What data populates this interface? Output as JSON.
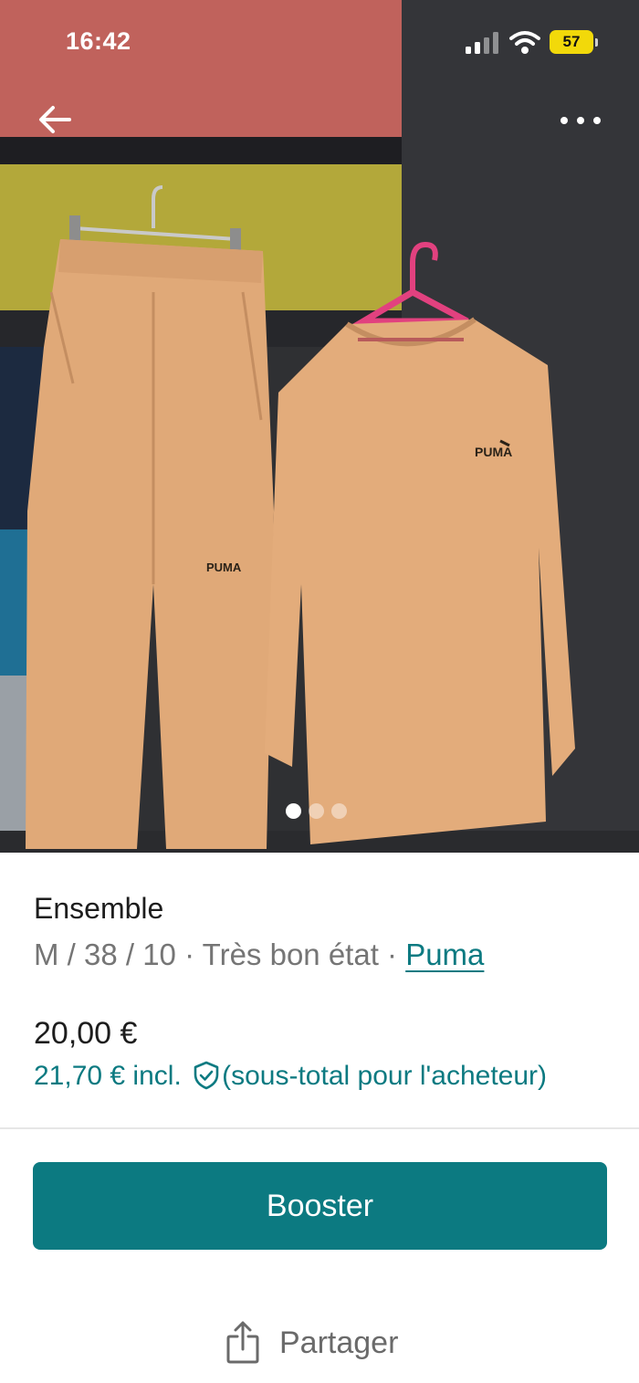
{
  "status_bar": {
    "time": "16:42",
    "battery_level": "57",
    "icons": [
      "signal-icon",
      "wifi-icon",
      "battery-icon"
    ]
  },
  "photo": {
    "icons": [
      "back-arrow-icon",
      "more-options-icon"
    ],
    "page_count": 3,
    "current_page": 1,
    "garment_brand_print": "PUMA",
    "colors": {
      "garment": "#e0a978",
      "hanger": "#e2417f",
      "wall": "#2f3033"
    }
  },
  "item": {
    "title": "Ensemble",
    "meta_prefix": "M / 38 / 10 · Très bon état · ",
    "brand": "Puma",
    "price": "20,00 €",
    "price_incl": "21,70 € incl.",
    "price_incl_note": "(sous-total pour l'acheteur)"
  },
  "actions": {
    "boost_label": "Booster",
    "share_label": "Partager"
  },
  "colors": {
    "accent": "#0c7a81",
    "muted_text": "#757575"
  }
}
